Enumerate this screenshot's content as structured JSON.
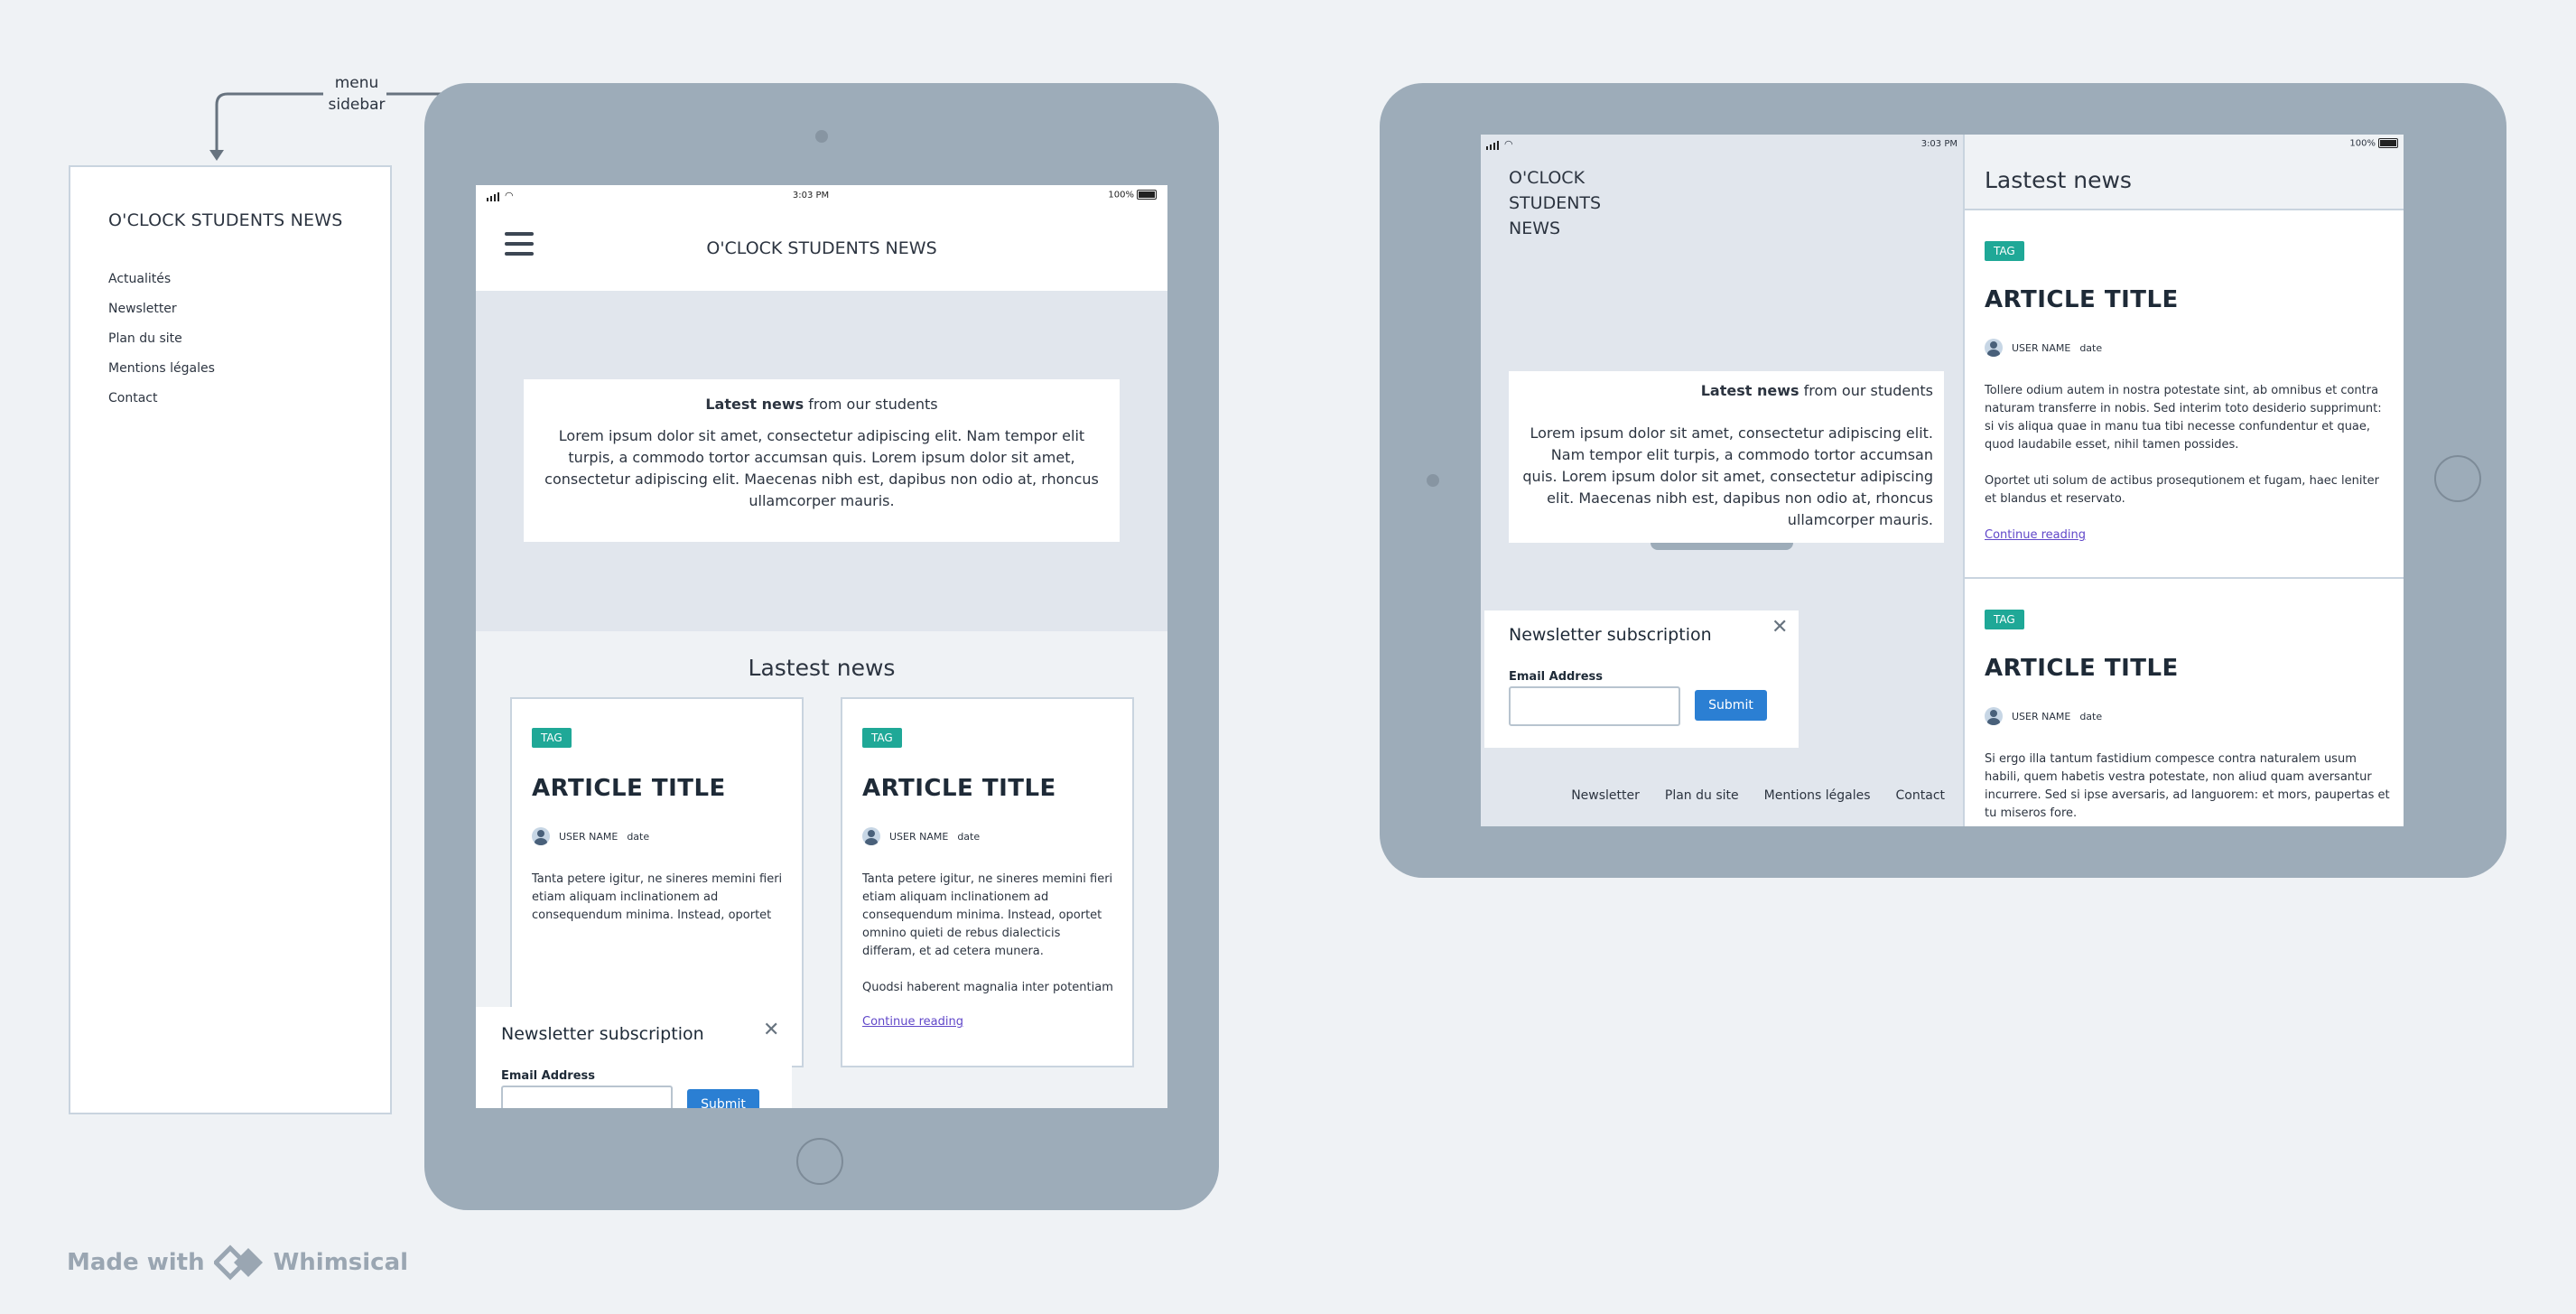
{
  "annotation": {
    "line1": "menu",
    "line2": "sidebar"
  },
  "sidebar": {
    "title": "O'CLOCK STUDENTS NEWS",
    "items": [
      {
        "label": "Actualités"
      },
      {
        "label": "Newsletter"
      },
      {
        "label": "Plan du site"
      },
      {
        "label": "Mentions légales"
      },
      {
        "label": "Contact"
      }
    ]
  },
  "portrait": {
    "status": {
      "time": "3:03 PM",
      "battery": "100%"
    },
    "header_title": "O'CLOCK STUDENTS NEWS",
    "hero": {
      "bold": "Latest news",
      "rest": " from our students",
      "text": "Lorem ipsum dolor sit amet, consectetur adipiscing elit. Nam tempor elit turpis, a commodo tortor accumsan quis. Lorem ipsum dolor sit amet, consectetur adipiscing elit. Maecenas nibh est, dapibus non odio at, rhoncus ullamcorper mauris."
    },
    "section_title": "Lastest news",
    "articles": [
      {
        "tag": "TAG",
        "title": "ARTICLE TITLE",
        "user": "USER NAME",
        "date": "date",
        "text": "Tanta petere igitur, ne sineres memini fieri etiam aliquam inclinationem ad consequendum minima. Instead, oportet"
      },
      {
        "tag": "TAG",
        "title": "ARTICLE TITLE",
        "user": "USER NAME",
        "date": "date",
        "text": "Tanta petere igitur, ne sineres memini fieri etiam aliquam inclinationem ad consequendum minima. Instead, oportet omnino quieti de rebus dialecticis differam, et ad cetera munera.",
        "text2": "Quodsi haberent magnalia inter potentiam",
        "link": "Continue reading"
      }
    ],
    "newsletter": {
      "title": "Newsletter subscription",
      "label": "Email Address",
      "button": "Submit",
      "close": "✕"
    }
  },
  "landscape": {
    "status": {
      "time": "3:03 PM",
      "battery": "100%"
    },
    "logo_lines": [
      "O'CLOCK",
      "STUDENTS",
      "NEWS"
    ],
    "hero": {
      "bold": "Latest news",
      "rest": " from our students",
      "text": "Lorem ipsum dolor sit amet, consectetur adipiscing elit. Nam tempor elit turpis, a commodo tortor accumsan quis. Lorem ipsum dolor sit amet, consectetur adipiscing elit. Maecenas nibh est, dapibus non odio at, rhoncus ullamcorper mauris."
    },
    "newsletter": {
      "title": "Newsletter subscription",
      "label": "Email Address",
      "button": "Submit",
      "close": "✕"
    },
    "footer_links": [
      "Newsletter",
      "Plan du site",
      "Mentions légales",
      "Contact"
    ],
    "section_title": "Lastest news",
    "articles": [
      {
        "tag": "TAG",
        "title": "ARTICLE TITLE",
        "user": "USER NAME",
        "date": "date",
        "text": "Tollere odium autem in nostra potestate sint, ab omnibus et contra naturam transferre in nobis. Sed interim toto desiderio supprimunt: si vis aliqua quae in manu tua tibi necesse confundentur et quae, quod laudabile esset, nihil tamen possides.",
        "text2": "Oportet uti solum de actibus prosequtionem et fugam, haec leniter et blandus et reservato.",
        "link": "Continue reading"
      },
      {
        "tag": "TAG",
        "title": "ARTICLE TITLE",
        "user": "USER NAME",
        "date": "date",
        "text": "Si ergo illa tantum fastidium compesce contra naturalem usum habili, quem habetis vestra potestate, non aliud quam aversantur incurrere. Sed si ipse aversaris, ad languorem: et mors, paupertas et tu miseros fore."
      }
    ]
  },
  "footer": {
    "made_with": "Made with",
    "brand": "Whimsical"
  }
}
